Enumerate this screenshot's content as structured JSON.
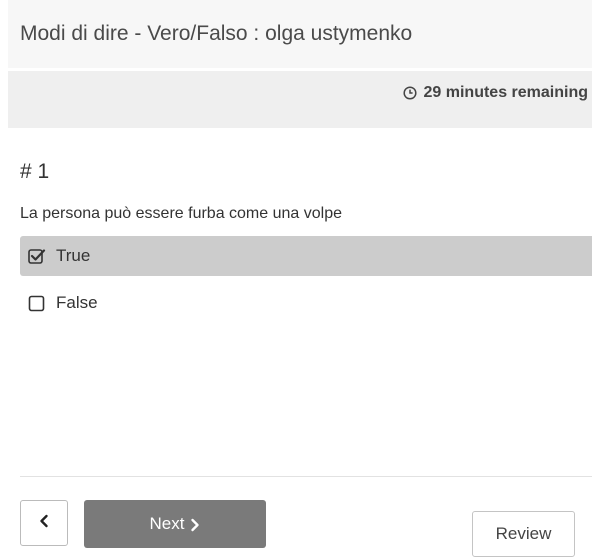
{
  "header": {
    "title": "Modi di dire - Vero/Falso : olga ustymenko"
  },
  "timer": {
    "icon": "clock-icon",
    "text": "29 minutes remaining"
  },
  "question": {
    "number": "# 1",
    "text": "La persona può essere furba come una volpe",
    "options": [
      {
        "label": "True",
        "checked": true
      },
      {
        "label": "False",
        "checked": false
      }
    ]
  },
  "navigation": {
    "prev_icon": "chevron-left-icon",
    "next_label": "Next",
    "next_icon": "chevron-right-icon",
    "review_label": "Review"
  },
  "colors": {
    "selected_option_bg": "#cccccc",
    "next_button_bg": "#7a7a7a",
    "title_bar_bg": "#f7f7f7",
    "timer_bar_bg": "#efefef"
  }
}
